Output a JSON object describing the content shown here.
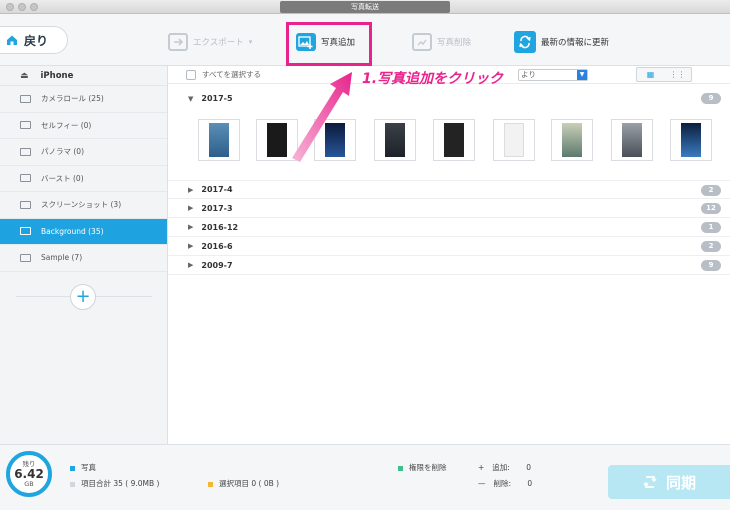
{
  "window": {
    "title": "写真転送"
  },
  "toolbar": {
    "back_label": "戻り",
    "export_label": "エクスポート",
    "add_label": "写真追加",
    "delete_label": "写真削除",
    "refresh_label": "最新の情報に更新"
  },
  "callout": {
    "text": "1.写真追加をクリック"
  },
  "sidebar": {
    "device": "iPhone",
    "items": [
      {
        "label": "カメラロール (25)",
        "icon": "camera-icon"
      },
      {
        "label": "セルフィー (0)",
        "icon": "selfie-icon"
      },
      {
        "label": "パノラマ (0)",
        "icon": "panorama-icon"
      },
      {
        "label": "バースト (0)",
        "icon": "burst-icon"
      },
      {
        "label": "スクリーンショット (3)",
        "icon": "screenshot-icon"
      },
      {
        "label": "Background (35)",
        "icon": "album-icon",
        "selected": true
      },
      {
        "label": "Sample (7)",
        "icon": "album-icon"
      }
    ],
    "add_symbol": "+"
  },
  "main": {
    "select_all": "すべてを選択する",
    "sort_value": "より",
    "groups": [
      {
        "label": "2017-5",
        "count": "9",
        "expanded": true
      },
      {
        "label": "2017-4",
        "count": "2"
      },
      {
        "label": "2017-3",
        "count": "12"
      },
      {
        "label": "2016-12",
        "count": "1"
      },
      {
        "label": "2016-6",
        "count": "2"
      },
      {
        "label": "2009-7",
        "count": "9"
      }
    ]
  },
  "footer": {
    "storage_top": "残り",
    "storage_value": "6.42",
    "storage_unit": "GB",
    "photos_label": "写真",
    "total_label": "項目合計 35 ( 9.0MB )",
    "selected_label": "選択項目 0 ( 0B )",
    "permission_label": "権限を削除",
    "add_label": "追加:",
    "add_value": "0",
    "delete_label": "削除:",
    "delete_value": "0",
    "sync_label": "同期"
  },
  "colors": {
    "accent": "#21a5e0",
    "highlight": "#e8248c"
  }
}
